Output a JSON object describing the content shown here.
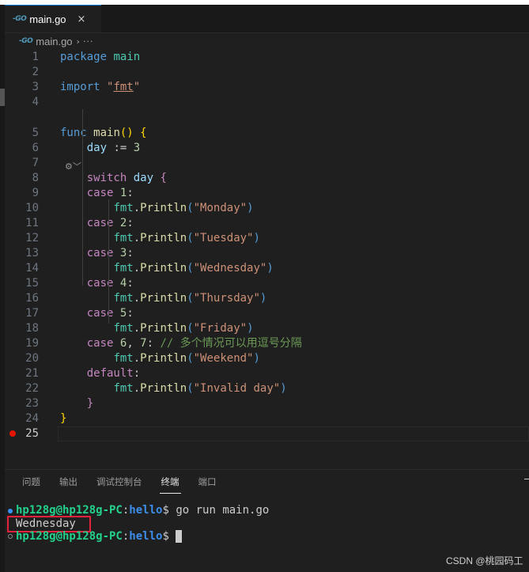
{
  "tab": {
    "icon": "go-file-icon",
    "icon_text": "-GO",
    "label": "main.go",
    "close_glyph": "×"
  },
  "breadcrumb": {
    "icon_text": "-GO",
    "file": "main.go",
    "separator": "›",
    "more": "···"
  },
  "editor": {
    "codelens_glyph": "⚙︎﹀",
    "line_numbers": [
      "1",
      "2",
      "3",
      "4",
      "5",
      "6",
      "7",
      "8",
      "9",
      "10",
      "11",
      "12",
      "13",
      "14",
      "15",
      "16",
      "17",
      "18",
      "19",
      "20",
      "21",
      "22",
      "23",
      "24",
      "25"
    ],
    "code": [
      [
        [
          "k",
          "package"
        ],
        [
          "p",
          " "
        ],
        [
          "t",
          "main"
        ]
      ],
      [],
      [
        [
          "k",
          "import"
        ],
        [
          "p",
          " "
        ],
        [
          "s",
          "\""
        ],
        [
          "su",
          "fmt"
        ],
        [
          "s",
          "\""
        ]
      ],
      [],
      [
        [
          "k",
          "func"
        ],
        [
          "p",
          " "
        ],
        [
          "f",
          "main"
        ],
        [
          "y",
          "()"
        ],
        [
          "p",
          " "
        ],
        [
          "y",
          "{"
        ]
      ],
      [
        [
          "p",
          "    "
        ],
        [
          "v",
          "day"
        ],
        [
          "p",
          " := "
        ],
        [
          "n",
          "3"
        ]
      ],
      [],
      [
        [
          "p",
          "    "
        ],
        [
          "c",
          "switch"
        ],
        [
          "p",
          " "
        ],
        [
          "v",
          "day"
        ],
        [
          "p",
          " "
        ],
        [
          "c",
          "{"
        ]
      ],
      [
        [
          "p",
          "    "
        ],
        [
          "c",
          "case"
        ],
        [
          "p",
          " "
        ],
        [
          "n",
          "1"
        ],
        [
          "p",
          ":"
        ]
      ],
      [
        [
          "p",
          "        "
        ],
        [
          "t",
          "fmt"
        ],
        [
          "p",
          "."
        ],
        [
          "f",
          "Println"
        ],
        [
          "k",
          "("
        ],
        [
          "s",
          "\"Monday\""
        ],
        [
          "k",
          ")"
        ]
      ],
      [
        [
          "p",
          "    "
        ],
        [
          "c",
          "case"
        ],
        [
          "p",
          " "
        ],
        [
          "n",
          "2"
        ],
        [
          "p",
          ":"
        ]
      ],
      [
        [
          "p",
          "        "
        ],
        [
          "t",
          "fmt"
        ],
        [
          "p",
          "."
        ],
        [
          "f",
          "Println"
        ],
        [
          "k",
          "("
        ],
        [
          "s",
          "\"Tuesday\""
        ],
        [
          "k",
          ")"
        ]
      ],
      [
        [
          "p",
          "    "
        ],
        [
          "c",
          "case"
        ],
        [
          "p",
          " "
        ],
        [
          "n",
          "3"
        ],
        [
          "p",
          ":"
        ]
      ],
      [
        [
          "p",
          "        "
        ],
        [
          "t",
          "fmt"
        ],
        [
          "p",
          "."
        ],
        [
          "f",
          "Println"
        ],
        [
          "k",
          "("
        ],
        [
          "s",
          "\"Wednesday\""
        ],
        [
          "k",
          ")"
        ]
      ],
      [
        [
          "p",
          "    "
        ],
        [
          "c",
          "case"
        ],
        [
          "p",
          " "
        ],
        [
          "n",
          "4"
        ],
        [
          "p",
          ":"
        ]
      ],
      [
        [
          "p",
          "        "
        ],
        [
          "t",
          "fmt"
        ],
        [
          "p",
          "."
        ],
        [
          "f",
          "Println"
        ],
        [
          "k",
          "("
        ],
        [
          "s",
          "\"Thursday\""
        ],
        [
          "k",
          ")"
        ]
      ],
      [
        [
          "p",
          "    "
        ],
        [
          "c",
          "case"
        ],
        [
          "p",
          " "
        ],
        [
          "n",
          "5"
        ],
        [
          "p",
          ":"
        ]
      ],
      [
        [
          "p",
          "        "
        ],
        [
          "t",
          "fmt"
        ],
        [
          "p",
          "."
        ],
        [
          "f",
          "Println"
        ],
        [
          "k",
          "("
        ],
        [
          "s",
          "\"Friday\""
        ],
        [
          "k",
          ")"
        ]
      ],
      [
        [
          "p",
          "    "
        ],
        [
          "c",
          "case"
        ],
        [
          "p",
          " "
        ],
        [
          "n",
          "6"
        ],
        [
          "p",
          ", "
        ],
        [
          "n",
          "7"
        ],
        [
          "p",
          ": "
        ],
        [
          "cm",
          "// 多个情况可以用逗号分隔"
        ]
      ],
      [
        [
          "p",
          "        "
        ],
        [
          "t",
          "fmt"
        ],
        [
          "p",
          "."
        ],
        [
          "f",
          "Println"
        ],
        [
          "k",
          "("
        ],
        [
          "s",
          "\"Weekend\""
        ],
        [
          "k",
          ")"
        ]
      ],
      [
        [
          "p",
          "    "
        ],
        [
          "c",
          "default"
        ],
        [
          "p",
          ":"
        ]
      ],
      [
        [
          "p",
          "        "
        ],
        [
          "t",
          "fmt"
        ],
        [
          "p",
          "."
        ],
        [
          "f",
          "Println"
        ],
        [
          "k",
          "("
        ],
        [
          "s",
          "\"Invalid day\""
        ],
        [
          "k",
          ")"
        ]
      ],
      [
        [
          "p",
          "    "
        ],
        [
          "c",
          "}"
        ]
      ],
      [
        [
          "y",
          "}"
        ]
      ],
      []
    ]
  },
  "panel": {
    "tabs": [
      "问题",
      "输出",
      "调试控制台",
      "终端",
      "端口"
    ]
  },
  "terminal": {
    "user_host": "hp128g@hp128g-PC",
    "colon": ":",
    "dir": "hello",
    "prompt": "$",
    "command": " go run main.go",
    "output": "Wednesday"
  },
  "watermark": "CSDN @桃园码工",
  "colors": {
    "accent": "#0078d4",
    "breakpoint": "#e51400",
    "highlight_box": "#e5213b",
    "terminal_green": "#23d18b",
    "terminal_blue": "#3b8eea"
  }
}
